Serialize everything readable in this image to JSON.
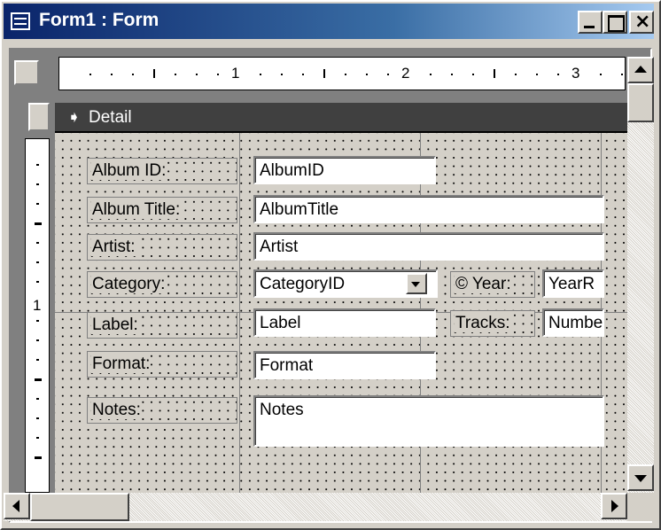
{
  "window": {
    "title": "Form1 : Form"
  },
  "ruler": {
    "h_numbers": [
      "1",
      "2",
      "3"
    ],
    "v_numbers": [
      "1"
    ]
  },
  "section": {
    "label": "Detail"
  },
  "labels": {
    "album_id": "Album ID:",
    "album_title": "Album Title:",
    "artist": "Artist:",
    "category": "Category:",
    "year": "© Year:",
    "label": "Label:",
    "tracks": "Tracks:",
    "format": "Format:",
    "notes": "Notes:"
  },
  "fields": {
    "album_id": "AlbumID",
    "album_title": "AlbumTitle",
    "artist": "Artist",
    "category": "CategoryID",
    "year": "YearR",
    "label": "Label",
    "tracks": "Numbe",
    "format": "Format",
    "notes": "Notes"
  }
}
